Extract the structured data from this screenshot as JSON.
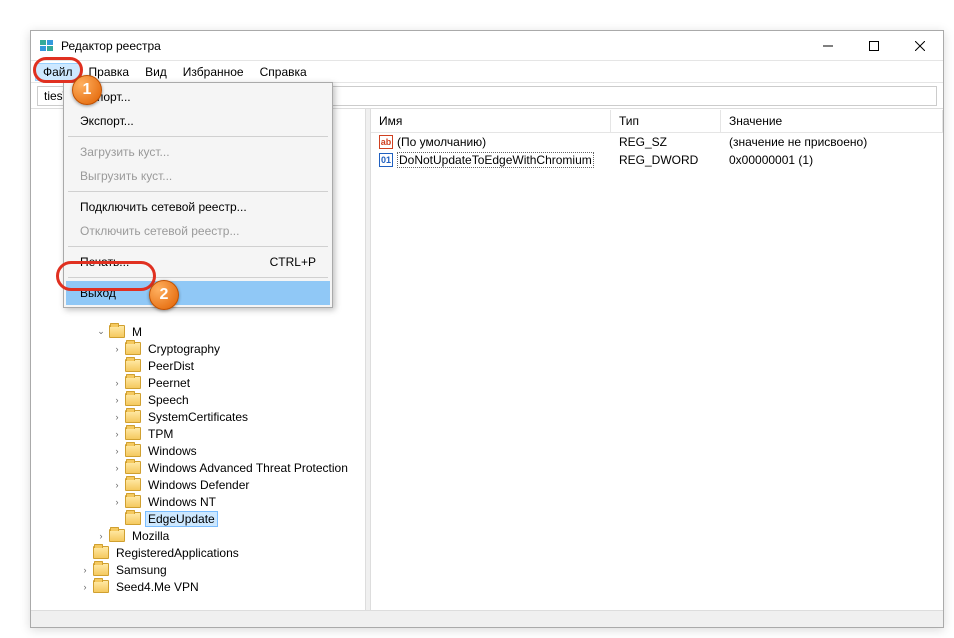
{
  "window": {
    "title": "Редактор реестра"
  },
  "menubar": {
    "file": "Файл",
    "edit": "Правка",
    "view": "Вид",
    "favorites": "Избранное",
    "help": "Справка"
  },
  "file_menu": {
    "import": "Импорт...",
    "export": "Экспорт...",
    "load_hive": "Загрузить куст...",
    "unload_hive": "Выгрузить куст...",
    "connect_network": "Подключить сетевой реестр...",
    "disconnect_network": "Отключить сетевой реестр...",
    "print": "Печать...",
    "print_shortcut": "CTRL+P",
    "exit": "Выход"
  },
  "address_path": "ties\\Microsoft\\EdgeUpdate",
  "list": {
    "headers": {
      "name": "Имя",
      "type": "Тип",
      "data": "Значение"
    },
    "rows": [
      {
        "icon": "sz",
        "name": "(По умолчанию)",
        "type": "REG_SZ",
        "data": "(значение не присвоено)",
        "selected": false
      },
      {
        "icon": "dw",
        "name": "DoNotUpdateToEdgeWithChromium",
        "type": "REG_DWORD",
        "data": "0x00000001 (1)",
        "selected": true
      }
    ]
  },
  "tree": {
    "microsoft_partial": "M",
    "children": [
      {
        "label": "Cryptography",
        "expandable": true
      },
      {
        "label": "PeerDist",
        "expandable": false
      },
      {
        "label": "Peernet",
        "expandable": true
      },
      {
        "label": "Speech",
        "expandable": true
      },
      {
        "label": "SystemCertificates",
        "expandable": true
      },
      {
        "label": "TPM",
        "expandable": true
      },
      {
        "label": "Windows",
        "expandable": true
      },
      {
        "label": "Windows Advanced Threat Protection",
        "expandable": true
      },
      {
        "label": "Windows Defender",
        "expandable": true
      },
      {
        "label": "Windows NT",
        "expandable": true
      },
      {
        "label": "EdgeUpdate",
        "expandable": false,
        "selected": true
      }
    ],
    "mozilla": "Mozilla",
    "siblings": [
      {
        "label": "RegisteredApplications",
        "expandable": false
      },
      {
        "label": "Samsung",
        "expandable": true
      },
      {
        "label": "Seed4.Me VPN",
        "expandable": true
      }
    ]
  },
  "callouts": {
    "badge1": "1",
    "badge2": "2"
  }
}
